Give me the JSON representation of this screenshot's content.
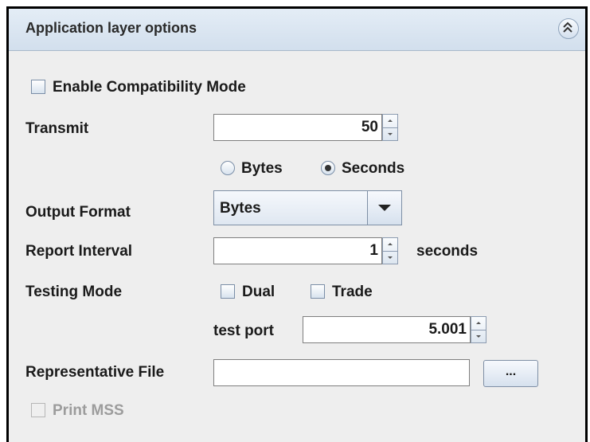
{
  "panel": {
    "title": "Application layer options"
  },
  "compat": {
    "label": "Enable Compatibility Mode",
    "checked": false
  },
  "transmit": {
    "label": "Transmit",
    "value": "50",
    "units": [
      "Bytes",
      "Seconds"
    ],
    "selected_unit": "Seconds"
  },
  "output_format": {
    "label": "Output Format",
    "selected": "Bytes"
  },
  "report_interval": {
    "label": "Report Interval",
    "value": "1",
    "unit": "seconds"
  },
  "testing_mode": {
    "label": "Testing Mode",
    "dual_label": "Dual",
    "trade_label": "Trade",
    "test_port_label": "test port",
    "test_port_value": "5.001"
  },
  "representative_file": {
    "label": "Representative File",
    "value": "",
    "browse_label": "..."
  },
  "print_mss": {
    "label": "Print MSS",
    "enabled": false
  }
}
